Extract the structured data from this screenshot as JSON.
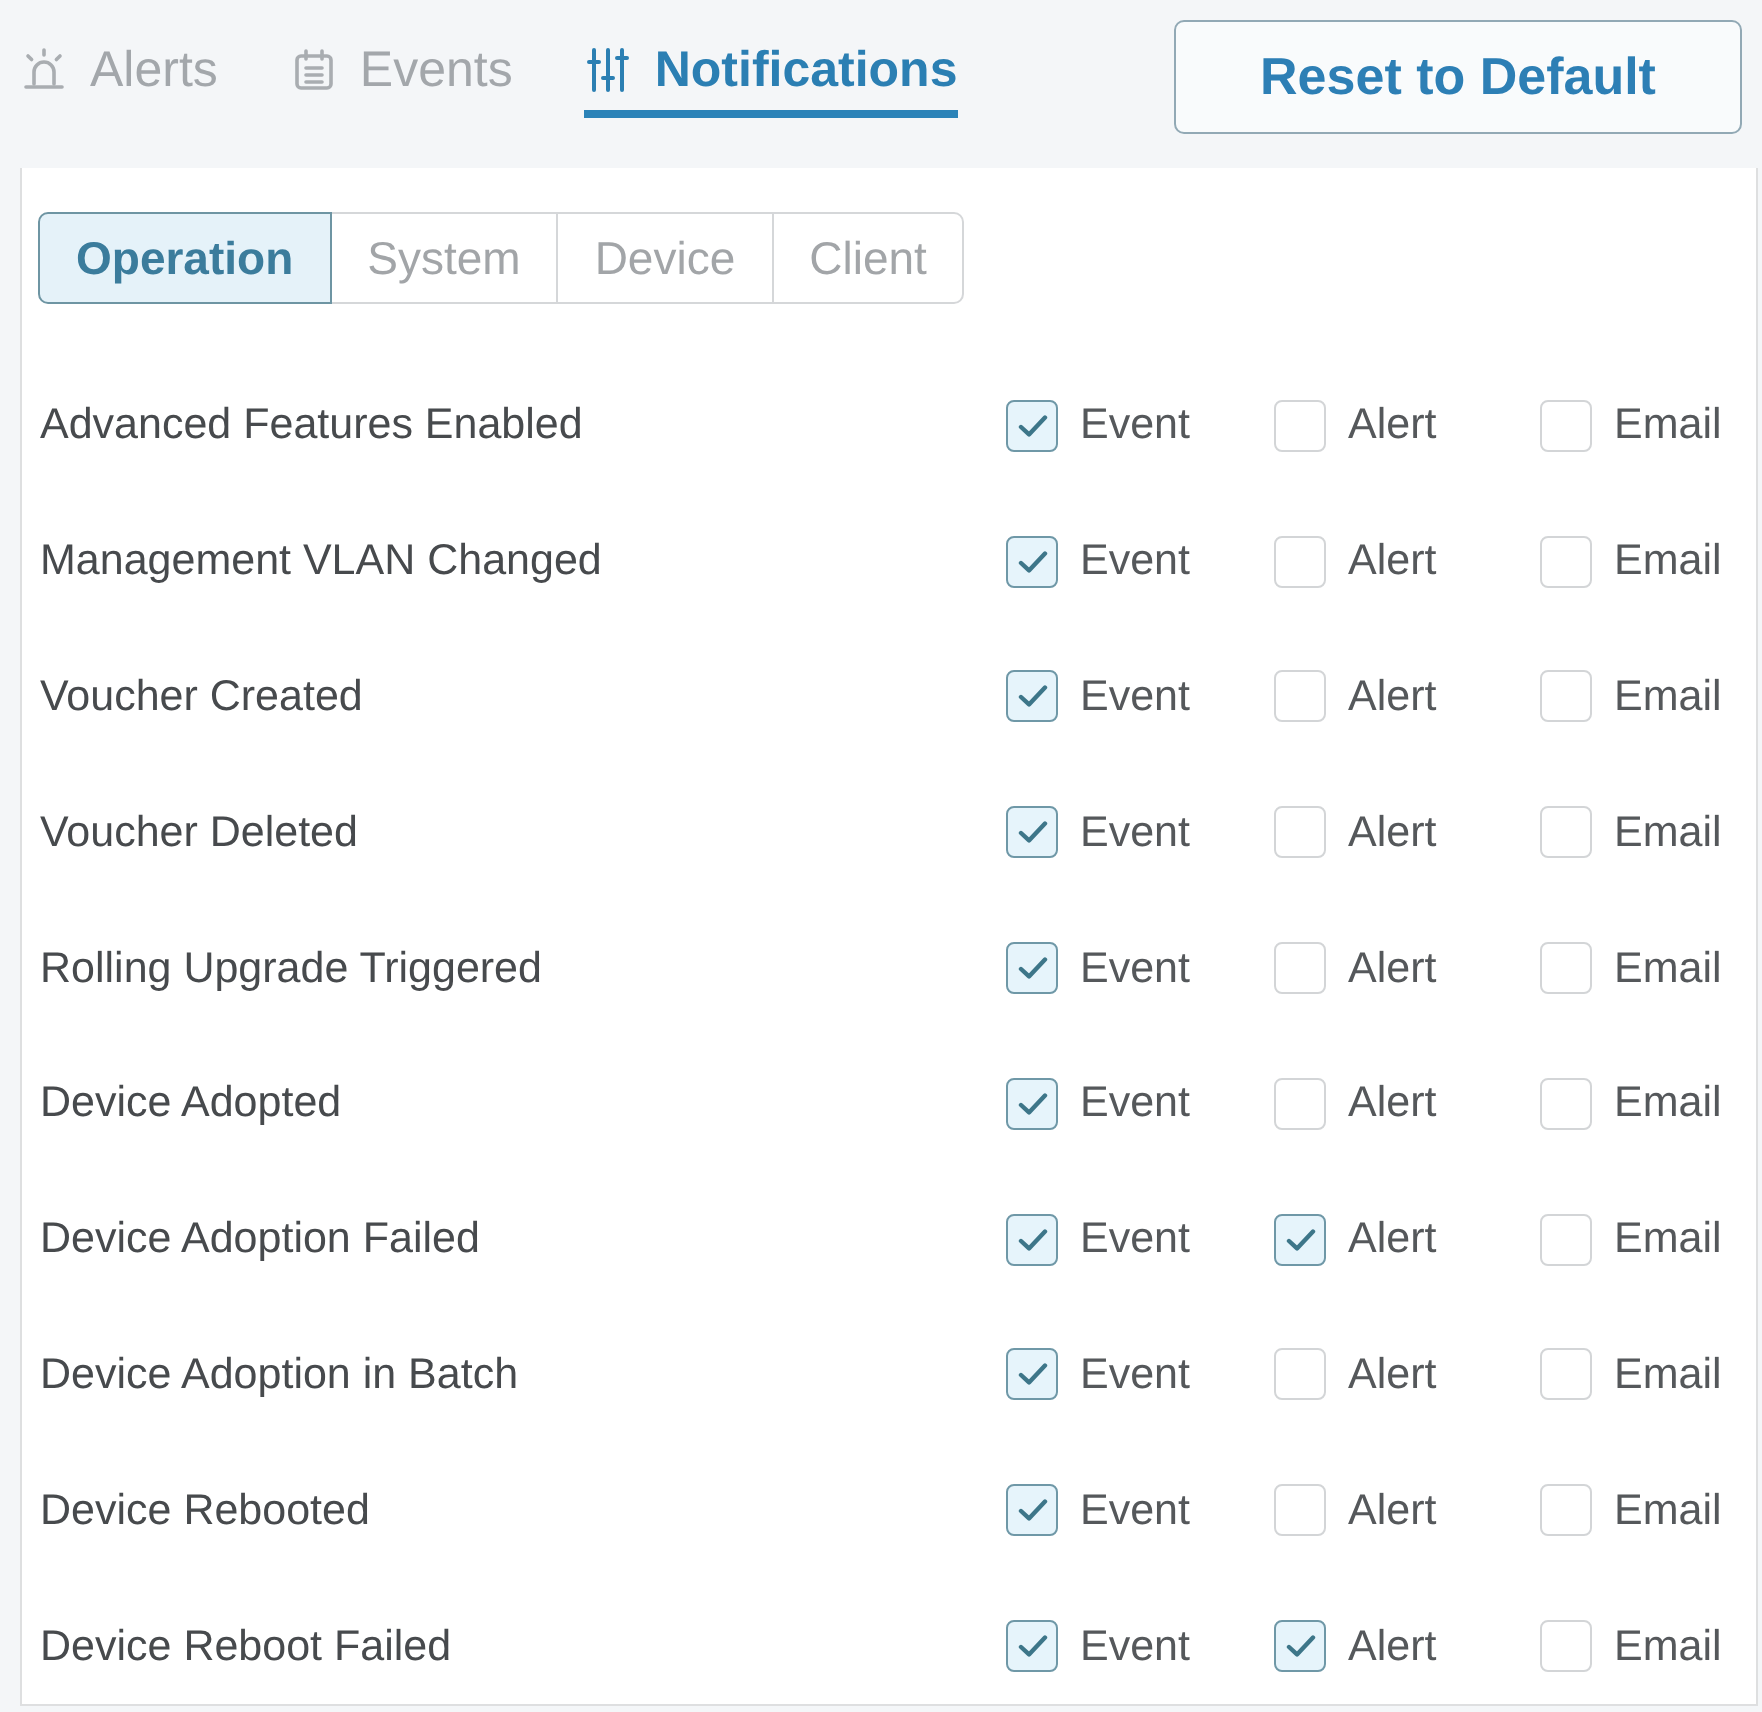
{
  "top_tabs": [
    {
      "label": "Alerts",
      "selected": false
    },
    {
      "label": "Events",
      "selected": false
    },
    {
      "label": "Notifications",
      "selected": true
    }
  ],
  "reset_button": {
    "label": "Reset to Default"
  },
  "category_tabs": [
    {
      "label": "Operation",
      "selected": true
    },
    {
      "label": "System",
      "selected": false
    },
    {
      "label": "Device",
      "selected": false
    },
    {
      "label": "Client",
      "selected": false
    }
  ],
  "rows": [
    {
      "name": "Advanced Features Enabled",
      "options": [
        {
          "label": "Event",
          "checked": true
        },
        {
          "label": "Alert",
          "checked": false
        },
        {
          "label": "Email",
          "checked": false
        }
      ]
    },
    {
      "name": "Management VLAN Changed",
      "options": [
        {
          "label": "Event",
          "checked": true
        },
        {
          "label": "Alert",
          "checked": false
        },
        {
          "label": "Email",
          "checked": false
        }
      ]
    },
    {
      "name": "Voucher Created",
      "options": [
        {
          "label": "Event",
          "checked": true
        },
        {
          "label": "Alert",
          "checked": false
        },
        {
          "label": "Email",
          "checked": false
        }
      ]
    },
    {
      "name": "Voucher Deleted",
      "options": [
        {
          "label": "Event",
          "checked": true
        },
        {
          "label": "Alert",
          "checked": false
        },
        {
          "label": "Email",
          "checked": false
        }
      ]
    },
    {
      "name": "Rolling Upgrade Triggered",
      "options": [
        {
          "label": "Event",
          "checked": true
        },
        {
          "label": "Alert",
          "checked": false
        },
        {
          "label": "Email",
          "checked": false
        }
      ]
    },
    {
      "name": "Device Adopted",
      "options": [
        {
          "label": "Event",
          "checked": true
        },
        {
          "label": "Alert",
          "checked": false
        },
        {
          "label": "Email",
          "checked": false
        }
      ]
    },
    {
      "name": "Device Adoption Failed",
      "options": [
        {
          "label": "Event",
          "checked": true
        },
        {
          "label": "Alert",
          "checked": true
        },
        {
          "label": "Email",
          "checked": false
        }
      ]
    },
    {
      "name": "Device Adoption in Batch",
      "options": [
        {
          "label": "Event",
          "checked": true
        },
        {
          "label": "Alert",
          "checked": false
        },
        {
          "label": "Email",
          "checked": false
        }
      ]
    },
    {
      "name": "Device Rebooted",
      "options": [
        {
          "label": "Event",
          "checked": true
        },
        {
          "label": "Alert",
          "checked": false
        },
        {
          "label": "Email",
          "checked": false
        }
      ]
    },
    {
      "name": "Device Reboot Failed",
      "options": [
        {
          "label": "Event",
          "checked": true
        },
        {
          "label": "Alert",
          "checked": true
        },
        {
          "label": "Email",
          "checked": false
        }
      ]
    }
  ]
}
